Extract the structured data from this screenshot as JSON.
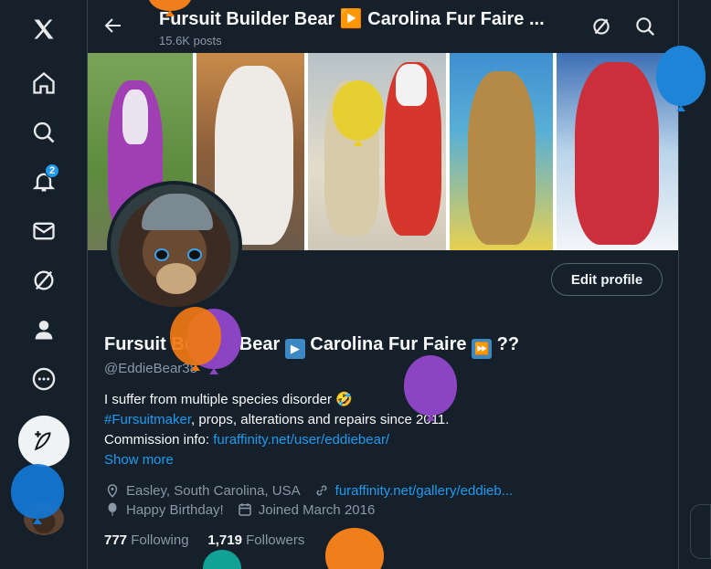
{
  "nav": {
    "notification_count": "2"
  },
  "header": {
    "title": "Fursuit Builder Bear ▶️ Carolina Fur Faire ...",
    "posts": "15.6K posts"
  },
  "profile": {
    "name_part1": "Fursuit Builder Bear ",
    "name_part2": " Carolina Fur Faire ",
    "name_part3": " ??",
    "handle": "@EddieBear38",
    "edit_label": "Edit profile",
    "bio_line1": "I suffer from multiple species disorder 🤣",
    "bio_hashtag": "#Fursuitmaker",
    "bio_line2_rest": ", props, alterations and repairs since 2011.",
    "bio_line3_prefix": "Commission info: ",
    "bio_link": "furaffinity.net/user/eddiebear/",
    "show_more": "Show more",
    "location": "Easley, South Carolina, USA",
    "website": "furaffinity.net/gallery/eddieb...",
    "birthday": "Happy Birthday!",
    "joined": "Joined March 2016",
    "following_count": "777",
    "following_label": "Following",
    "followers_count": "1,719",
    "followers_label": "Followers"
  },
  "colors": {
    "background": "#15202b",
    "accent": "#1d9bf0",
    "muted": "#8b98a5",
    "border": "#38444d"
  },
  "icons": [
    "x-logo-icon",
    "home-icon",
    "search-icon",
    "notifications-icon",
    "messages-icon",
    "grok-icon",
    "profile-icon",
    "more-icon",
    "post-icon",
    "back-arrow-icon",
    "location-icon",
    "link-icon",
    "balloon-icon",
    "calendar-icon"
  ]
}
